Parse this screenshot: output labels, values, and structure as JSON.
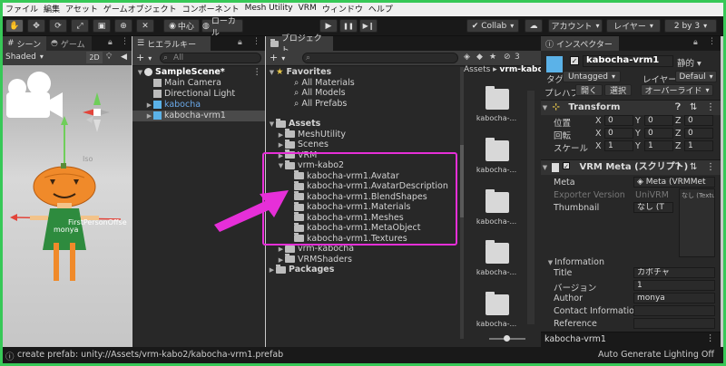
{
  "menu": [
    "ファイル",
    "編集",
    "アセット",
    "ゲームオブジェクト",
    "コンポーネント",
    "Mesh Utility",
    "VRM",
    "ウィンドウ",
    "ヘルプ"
  ],
  "toolbar": {
    "pivot_label": "中心",
    "space_label": "ローカル",
    "collab_label": "Collab",
    "account_label": "アカウント",
    "layers_label": "レイヤー",
    "layout_label": "2 by 3",
    "play_icon": "▶",
    "pause_icon": "❚❚",
    "step_icon": "▶❙"
  },
  "scene": {
    "tab_label": "シーン",
    "game_tab_label": "ゲーム",
    "shading_mode": "Shaded",
    "mode_2d": "2D",
    "iso_label": "Iso",
    "overlay_text": "FirstPersonOffse",
    "shirt_text": "monya"
  },
  "hierarchy": {
    "tab_label": "ヒエラルキー",
    "search_placeholder": "All",
    "add_label": "+",
    "items": [
      {
        "label": "SampleScene*",
        "depth": 0,
        "icon": "unity-icon",
        "expanded": true,
        "selected": false,
        "color": "#ffffff",
        "bold": true
      },
      {
        "label": "Main Camera",
        "depth": 1,
        "icon": "cube-icon",
        "expanded": false,
        "selected": false,
        "color": "#d2d2d2",
        "bold": false
      },
      {
        "label": "Directional Light",
        "depth": 1,
        "icon": "cube-icon",
        "expanded": false,
        "selected": false,
        "color": "#d2d2d2",
        "bold": false
      },
      {
        "label": "kabocha",
        "depth": 1,
        "icon": "prefab-icon",
        "expanded": false,
        "selected": false,
        "color": "#6aa8e8",
        "bold": false
      },
      {
        "label": "kabocha-vrm1",
        "depth": 1,
        "icon": "prefab-icon",
        "expanded": false,
        "selected": true,
        "color": "#d2d2d2",
        "bold": false
      }
    ]
  },
  "project": {
    "tab_label": "プロジェクト",
    "add_label": "+",
    "badge_count": "3",
    "favorites_label": "Favorites",
    "favorites": [
      "All Materials",
      "All Models",
      "All Prefabs"
    ],
    "assets_label": "Assets",
    "asset_items": [
      "MeshUtility",
      "Scenes",
      "VRM",
      "vrm-kabo2"
    ],
    "kabo2_children": [
      "kabocha-vrm1.Avatar",
      "kabocha-vrm1.AvatarDescription",
      "kabocha-vrm1.BlendShapes",
      "kabocha-vrm1.Materials",
      "kabocha-vrm1.Meshes",
      "kabocha-vrm1.MetaObject",
      "kabocha-vrm1.Textures"
    ],
    "after_items": [
      "vrm-kabocha",
      "VRMShaders"
    ],
    "packages_label": "Packages",
    "breadcrumb": [
      "Assets",
      "vrm-kabo"
    ],
    "grid_label": "kabocha-..."
  },
  "inspector": {
    "tab_label": "インスペクター",
    "object_name": "kabocha-vrm1",
    "static_label": "静的",
    "tag_label": "タグ",
    "tag_value": "Untagged",
    "layer_label": "レイヤー",
    "layer_value": "Defaul",
    "prefab_label": "プレハブ",
    "open_label": "開く",
    "select_label": "選択",
    "override_label": "オーバーライド",
    "transform_label": "Transform",
    "transform_rows": [
      {
        "label": "位置",
        "x": "0",
        "y": "0",
        "z": "0"
      },
      {
        "label": "回転",
        "x": "0",
        "y": "0",
        "z": "0"
      },
      {
        "label": "スケール",
        "x": "1",
        "y": "1",
        "z": "1"
      }
    ],
    "vrmmeta_label": "VRM Meta (スクリプト)",
    "meta_label": "Meta",
    "meta_value": "Meta (VRMMet",
    "exporter_label": "Exporter Version",
    "exporter_value": "UniVRM",
    "thumbnail_label": "Thumbnail",
    "thumbnail_value": "なし (T",
    "thumb_box_text": "なし (Textu",
    "information_label": "Information",
    "info_rows": [
      {
        "label": "Title",
        "value": "カボチャ"
      },
      {
        "label": "バージョン",
        "value": "1"
      },
      {
        "label": "Author",
        "value": "monya"
      },
      {
        "label": "Contact Information",
        "value": ""
      },
      {
        "label": "Reference",
        "value": ""
      }
    ],
    "footer_name": "kabocha-vrm1"
  },
  "status": {
    "message": "create prefab: unity://Assets/vrm-kabo2/kabocha-vrm1.prefab",
    "right_text": "Auto Generate Lighting Off"
  },
  "colors": {
    "highlight": "#e62fd8",
    "frame": "#37c857",
    "selection": "#2c5d87",
    "accent_blue": "#6aa8e8"
  }
}
